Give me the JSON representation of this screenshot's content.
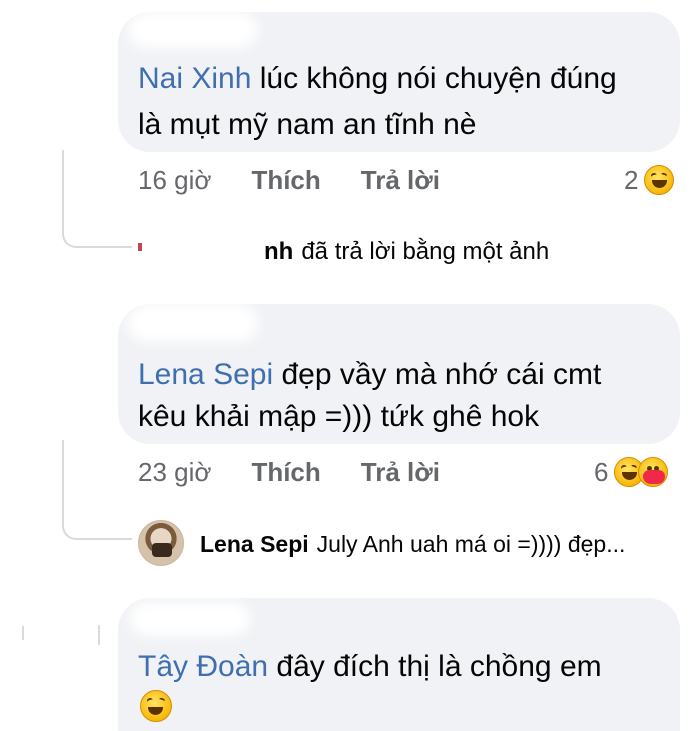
{
  "comments": [
    {
      "author": "Nai Xinh",
      "text_line1": "lúc không nói chuyện đúng",
      "text_line2": "là mụt mỹ nam an tĩnh nè",
      "time": "16 giờ",
      "like_label": "Thích",
      "reply_label": "Trả lời",
      "reaction_count": "2",
      "reactions": [
        "laughing-emoji"
      ]
    },
    {
      "author": "Lena Sepi",
      "text_line1": "đẹp vầy mà nhớ cái cmt",
      "text_line2": "kêu khải mập =))) tứk ghê hok",
      "time": "23 giờ",
      "like_label": "Thích",
      "reply_label": "Trả lời",
      "reaction_count": "6",
      "reactions": [
        "laughing-emoji",
        "care-emoji"
      ]
    },
    {
      "author": "Tây Đoàn",
      "text_line1": "đây đích thị là chồng em",
      "reactions_inline": [
        "tears-of-joy-emoji"
      ]
    }
  ],
  "photo_reply": {
    "name_fragment": "nh",
    "text": "đã trả lời bằng một ảnh"
  },
  "reply_preview": {
    "author": "Lena Sepi",
    "text": "July Anh uah má oi =)))) đẹp..."
  },
  "colors": {
    "bubble": "#f0f2f5",
    "author": "#3f6fb0",
    "meta": "#65676b",
    "text": "#050505"
  }
}
